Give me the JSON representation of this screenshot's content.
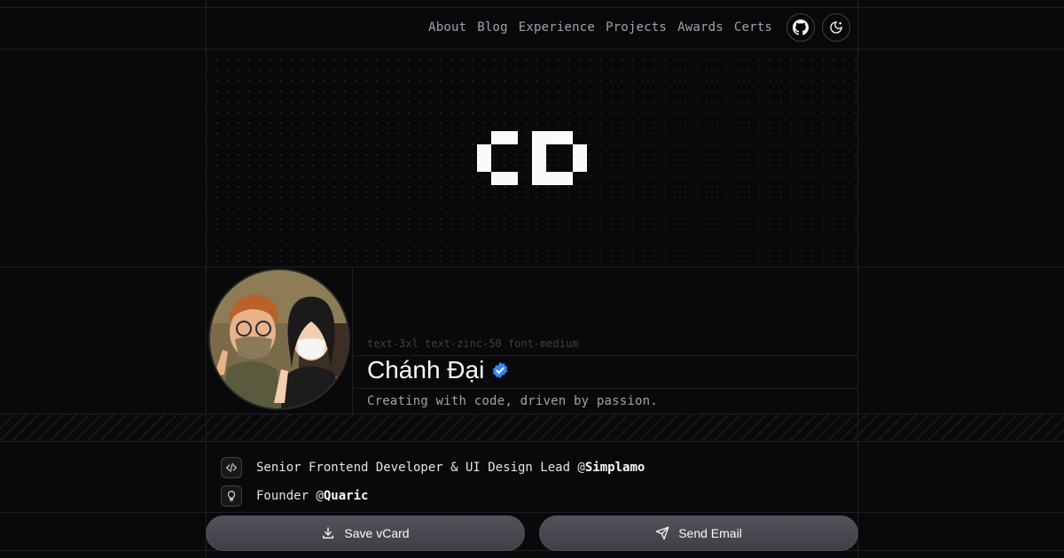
{
  "nav": {
    "links": [
      "About",
      "Blog",
      "Experience",
      "Projects",
      "Awards",
      "Certs"
    ],
    "icons": [
      "github-icon",
      "theme-toggle-icon"
    ]
  },
  "logo": {
    "icon": "cd-pixel-logo"
  },
  "profile": {
    "class_hint": "text-3xl text-zinc-50 font-medium",
    "name": "Chánh Đại",
    "verified_icon": "verified-badge-icon",
    "tagline": "Creating with code, driven by passion.",
    "avatar_icon": "avatar-illustration"
  },
  "info": [
    {
      "icon": "code-icon",
      "text": "Senior Frontend Developer & UI Design Lead @",
      "org": "Simplamo"
    },
    {
      "icon": "lightbulb-icon",
      "text": "Founder @",
      "org": "Quaric"
    }
  ],
  "actions": {
    "save_vcard": "Save vCard",
    "send_email": "Send Email"
  },
  "colors": {
    "background": "#09090b",
    "accent": "#3b82f6",
    "button": "#3f3f46"
  }
}
